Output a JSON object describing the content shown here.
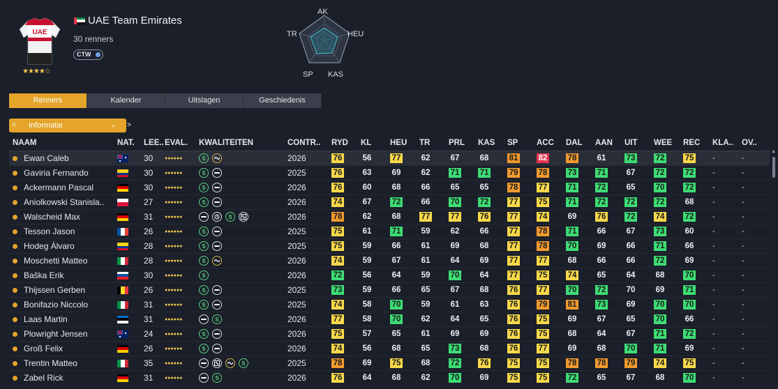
{
  "team": {
    "name": "UAE Team Emirates",
    "riders": "30 renners",
    "badge": "CTW",
    "stars": "★★★★☆",
    "jersey_text": "UAE"
  },
  "radar": {
    "labels": [
      "AK",
      "HEU",
      "KAS",
      "SP",
      "TR"
    ]
  },
  "tabs": [
    "Renners",
    "Kalender",
    "Uitslagen",
    "Geschiedenis"
  ],
  "dropdown": {
    "label": "Informatie",
    "prev": "<",
    "next": ">",
    "chev": "⌄"
  },
  "columns": [
    "NAAM",
    "NAT.",
    "LEE..",
    "EVAL.",
    "KWALITEITEN",
    "CONTR..",
    "RYD",
    "KL",
    "HEU",
    "TR",
    "PRL",
    "KAS",
    "SP",
    "ACC",
    "DAL",
    "AAN",
    "UIT",
    "WEE",
    "REC",
    "KLA..",
    "OV.."
  ],
  "colors": {
    "accent": "#e5a52a",
    "green": "#3ddc74",
    "yellow": "#f7d84a",
    "orange": "#f09a2e",
    "red": "#e4334f"
  },
  "rows": [
    {
      "name": "Ewan Caleb",
      "nat": "AU",
      "age": "30",
      "kw": [
        "s",
        "wave"
      ],
      "contract": "2026",
      "stats": [
        [
          "76",
          "y"
        ],
        [
          "56",
          ""
        ],
        [
          "77",
          "y"
        ],
        [
          "62",
          ""
        ],
        [
          "67",
          ""
        ],
        [
          "68",
          ""
        ],
        [
          "81",
          "o"
        ],
        [
          "82",
          "r"
        ],
        [
          "78",
          "o"
        ],
        [
          "61",
          ""
        ],
        [
          "73",
          "g"
        ],
        [
          "72",
          "g"
        ],
        [
          "75",
          "y"
        ]
      ],
      "kla": "-",
      "ov": "-"
    },
    {
      "name": "Gaviria Fernando",
      "nat": "CO",
      "age": "30",
      "kw": [
        "s",
        "dash"
      ],
      "contract": "2025",
      "stats": [
        [
          "76",
          "y"
        ],
        [
          "63",
          ""
        ],
        [
          "69",
          ""
        ],
        [
          "62",
          ""
        ],
        [
          "71",
          "g"
        ],
        [
          "71",
          "g"
        ],
        [
          "79",
          "o"
        ],
        [
          "78",
          "o"
        ],
        [
          "73",
          "g"
        ],
        [
          "71",
          "g"
        ],
        [
          "67",
          ""
        ],
        [
          "72",
          "g"
        ],
        [
          "72",
          "g"
        ]
      ],
      "kla": "-",
      "ov": "-"
    },
    {
      "name": "Ackermann Pascal",
      "nat": "DE",
      "age": "30",
      "kw": [
        "s",
        "dash"
      ],
      "contract": "2026",
      "stats": [
        [
          "76",
          "y"
        ],
        [
          "60",
          ""
        ],
        [
          "68",
          ""
        ],
        [
          "66",
          ""
        ],
        [
          "65",
          ""
        ],
        [
          "65",
          ""
        ],
        [
          "78",
          "o"
        ],
        [
          "77",
          "y"
        ],
        [
          "71",
          "g"
        ],
        [
          "72",
          "g"
        ],
        [
          "65",
          ""
        ],
        [
          "70",
          "g"
        ],
        [
          "72",
          "g"
        ]
      ],
      "kla": "-",
      "ov": "-"
    },
    {
      "name": "Aniolkowski Stanisla..",
      "nat": "PL",
      "age": "27",
      "kw": [
        "s",
        "dash"
      ],
      "contract": "2026",
      "stats": [
        [
          "74",
          "y"
        ],
        [
          "67",
          ""
        ],
        [
          "72",
          "g"
        ],
        [
          "66",
          ""
        ],
        [
          "70",
          "g"
        ],
        [
          "72",
          "g"
        ],
        [
          "77",
          "y"
        ],
        [
          "75",
          "y"
        ],
        [
          "71",
          "g"
        ],
        [
          "72",
          "g"
        ],
        [
          "72",
          "g"
        ],
        [
          "72",
          "g"
        ],
        [
          "68",
          ""
        ]
      ],
      "kla": "-",
      "ov": "-"
    },
    {
      "name": "Walscheid Max",
      "nat": "DE",
      "age": "31",
      "kw": [
        "dash",
        "clock",
        "s",
        "gear"
      ],
      "contract": "2026",
      "stats": [
        [
          "78",
          "o"
        ],
        [
          "62",
          ""
        ],
        [
          "68",
          ""
        ],
        [
          "77",
          "y"
        ],
        [
          "77",
          "y"
        ],
        [
          "76",
          "y"
        ],
        [
          "77",
          "y"
        ],
        [
          "74",
          "y"
        ],
        [
          "69",
          ""
        ],
        [
          "76",
          "y"
        ],
        [
          "72",
          "g"
        ],
        [
          "74",
          "y"
        ],
        [
          "72",
          "g"
        ]
      ],
      "kla": "-",
      "ov": "-"
    },
    {
      "name": "Tesson Jason",
      "nat": "FR",
      "age": "26",
      "kw": [
        "s",
        "dash"
      ],
      "contract": "2025",
      "stats": [
        [
          "75",
          "y"
        ],
        [
          "61",
          ""
        ],
        [
          "71",
          "g"
        ],
        [
          "59",
          ""
        ],
        [
          "62",
          ""
        ],
        [
          "66",
          ""
        ],
        [
          "77",
          "y"
        ],
        [
          "78",
          "o"
        ],
        [
          "71",
          "g"
        ],
        [
          "66",
          ""
        ],
        [
          "67",
          ""
        ],
        [
          "73",
          "g"
        ],
        [
          "60",
          ""
        ]
      ],
      "kla": "-",
      "ov": "-"
    },
    {
      "name": "Hodeg Álvaro",
      "nat": "CO",
      "age": "28",
      "kw": [
        "s",
        "dash"
      ],
      "contract": "2025",
      "stats": [
        [
          "75",
          "y"
        ],
        [
          "59",
          ""
        ],
        [
          "66",
          ""
        ],
        [
          "61",
          ""
        ],
        [
          "69",
          ""
        ],
        [
          "68",
          ""
        ],
        [
          "77",
          "y"
        ],
        [
          "78",
          "o"
        ],
        [
          "70",
          "g"
        ],
        [
          "69",
          ""
        ],
        [
          "66",
          ""
        ],
        [
          "71",
          "g"
        ],
        [
          "66",
          ""
        ]
      ],
      "kla": "-",
      "ov": "-"
    },
    {
      "name": "Moschetti Matteo",
      "nat": "IT",
      "age": "28",
      "kw": [
        "s",
        "wave"
      ],
      "contract": "2026",
      "stats": [
        [
          "74",
          "y"
        ],
        [
          "59",
          ""
        ],
        [
          "67",
          ""
        ],
        [
          "61",
          ""
        ],
        [
          "64",
          ""
        ],
        [
          "69",
          ""
        ],
        [
          "77",
          "y"
        ],
        [
          "77",
          "y"
        ],
        [
          "68",
          ""
        ],
        [
          "66",
          ""
        ],
        [
          "66",
          ""
        ],
        [
          "72",
          "g"
        ],
        [
          "69",
          ""
        ]
      ],
      "kla": "-",
      "ov": "-"
    },
    {
      "name": "Baška Erik",
      "nat": "SK",
      "age": "30",
      "kw": [
        "s"
      ],
      "contract": "2026",
      "stats": [
        [
          "72",
          "g"
        ],
        [
          "56",
          ""
        ],
        [
          "64",
          ""
        ],
        [
          "59",
          ""
        ],
        [
          "70",
          "g"
        ],
        [
          "64",
          ""
        ],
        [
          "77",
          "y"
        ],
        [
          "75",
          "y"
        ],
        [
          "74",
          "y"
        ],
        [
          "65",
          ""
        ],
        [
          "64",
          ""
        ],
        [
          "68",
          ""
        ],
        [
          "70",
          "g"
        ]
      ],
      "kla": "-",
      "ov": "-"
    },
    {
      "name": "Thijssen Gerben",
      "nat": "BE",
      "age": "26",
      "kw": [
        "s",
        "dash"
      ],
      "contract": "2025",
      "stats": [
        [
          "73",
          "g"
        ],
        [
          "59",
          ""
        ],
        [
          "66",
          ""
        ],
        [
          "65",
          ""
        ],
        [
          "67",
          ""
        ],
        [
          "68",
          ""
        ],
        [
          "76",
          "y"
        ],
        [
          "77",
          "y"
        ],
        [
          "70",
          "g"
        ],
        [
          "72",
          "g"
        ],
        [
          "70",
          ""
        ],
        [
          "69",
          ""
        ],
        [
          "71",
          "g"
        ]
      ],
      "kla": "-",
      "ov": "-"
    },
    {
      "name": "Bonifazio Niccolo",
      "nat": "IT",
      "age": "31",
      "kw": [
        "s",
        "dash"
      ],
      "contract": "2025",
      "stats": [
        [
          "74",
          "y"
        ],
        [
          "58",
          ""
        ],
        [
          "70",
          "g"
        ],
        [
          "59",
          ""
        ],
        [
          "61",
          ""
        ],
        [
          "63",
          ""
        ],
        [
          "76",
          "y"
        ],
        [
          "79",
          "o"
        ],
        [
          "81",
          "o"
        ],
        [
          "73",
          "g"
        ],
        [
          "69",
          ""
        ],
        [
          "70",
          "g"
        ],
        [
          "70",
          "g"
        ]
      ],
      "kla": "-",
      "ov": "-"
    },
    {
      "name": "Laas Martin",
      "nat": "EE",
      "age": "31",
      "kw": [
        "dash",
        "s"
      ],
      "contract": "2026",
      "stats": [
        [
          "77",
          "y"
        ],
        [
          "58",
          ""
        ],
        [
          "70",
          "g"
        ],
        [
          "62",
          ""
        ],
        [
          "64",
          ""
        ],
        [
          "65",
          ""
        ],
        [
          "76",
          "y"
        ],
        [
          "75",
          "y"
        ],
        [
          "69",
          ""
        ],
        [
          "67",
          ""
        ],
        [
          "65",
          ""
        ],
        [
          "70",
          "g"
        ],
        [
          "66",
          ""
        ]
      ],
      "kla": "-",
      "ov": "-"
    },
    {
      "name": "Plowright Jensen",
      "nat": "AU",
      "age": "24",
      "kw": [
        "s",
        "dash"
      ],
      "contract": "2026",
      "stats": [
        [
          "75",
          "y"
        ],
        [
          "57",
          ""
        ],
        [
          "65",
          ""
        ],
        [
          "61",
          ""
        ],
        [
          "69",
          ""
        ],
        [
          "69",
          ""
        ],
        [
          "76",
          "y"
        ],
        [
          "75",
          "y"
        ],
        [
          "68",
          ""
        ],
        [
          "64",
          ""
        ],
        [
          "67",
          ""
        ],
        [
          "71",
          "g"
        ],
        [
          "72",
          "g"
        ]
      ],
      "kla": "-",
      "ov": "-"
    },
    {
      "name": "Groß Felix",
      "nat": "DE",
      "age": "26",
      "kw": [
        "s",
        "dash"
      ],
      "contract": "2026",
      "stats": [
        [
          "74",
          "y"
        ],
        [
          "56",
          ""
        ],
        [
          "68",
          ""
        ],
        [
          "65",
          ""
        ],
        [
          "73",
          "g"
        ],
        [
          "68",
          ""
        ],
        [
          "76",
          "y"
        ],
        [
          "77",
          "y"
        ],
        [
          "69",
          ""
        ],
        [
          "68",
          ""
        ],
        [
          "70",
          "g"
        ],
        [
          "71",
          "g"
        ],
        [
          "69",
          ""
        ]
      ],
      "kla": "-",
      "ov": "-"
    },
    {
      "name": "Trentin Matteo",
      "nat": "IT",
      "age": "35",
      "kw": [
        "dash",
        "gear",
        "wave",
        "s"
      ],
      "contract": "2025",
      "stats": [
        [
          "78",
          "o"
        ],
        [
          "69",
          ""
        ],
        [
          "75",
          "y"
        ],
        [
          "68",
          ""
        ],
        [
          "72",
          "g"
        ],
        [
          "76",
          "y"
        ],
        [
          "75",
          "y"
        ],
        [
          "75",
          "y"
        ],
        [
          "78",
          "o"
        ],
        [
          "78",
          "o"
        ],
        [
          "79",
          "o"
        ],
        [
          "74",
          "y"
        ],
        [
          "75",
          "y"
        ]
      ],
      "kla": "-",
      "ov": "-"
    },
    {
      "name": "Zabel Rick",
      "nat": "DE",
      "age": "31",
      "kw": [
        "dash",
        "s"
      ],
      "contract": "2026",
      "stats": [
        [
          "76",
          "y"
        ],
        [
          "64",
          ""
        ],
        [
          "68",
          ""
        ],
        [
          "62",
          ""
        ],
        [
          "70",
          "g"
        ],
        [
          "69",
          ""
        ],
        [
          "75",
          "y"
        ],
        [
          "75",
          "y"
        ],
        [
          "72",
          "g"
        ],
        [
          "65",
          ""
        ],
        [
          "67",
          ""
        ],
        [
          "68",
          ""
        ],
        [
          "70",
          "g"
        ]
      ],
      "kla": "-",
      "ov": "-"
    }
  ]
}
